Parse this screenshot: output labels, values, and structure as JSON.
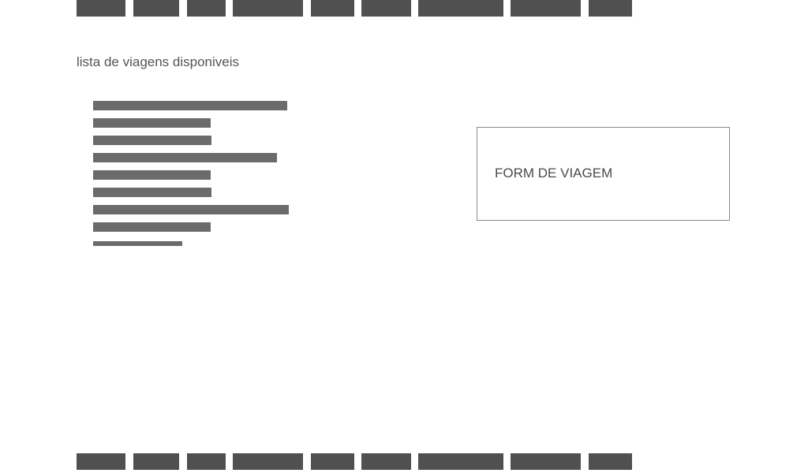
{
  "main": {
    "title": "lista de viagens disponiveis"
  },
  "trip_form": {
    "title": "FORM DE VIAGEM"
  },
  "colors": {
    "nav_block": "#505050",
    "list_item": "#6b6b6b",
    "title_text": "#555555",
    "form_border": "#8a8a8a"
  }
}
